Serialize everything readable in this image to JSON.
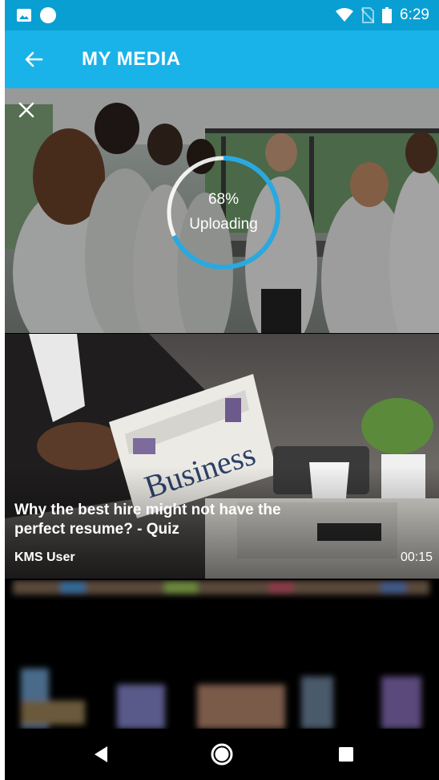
{
  "status_bar": {
    "time": "6:29",
    "icons": [
      "image-icon",
      "circle-icon",
      "wifi-icon",
      "no-sim-icon",
      "battery-icon"
    ]
  },
  "app_bar": {
    "back_icon": "arrow-back-icon",
    "title": "MY MEDIA"
  },
  "upload": {
    "close_icon": "close-icon",
    "progress_text": "68%",
    "progress_fraction": 0.68,
    "status_label": "Uploading",
    "ring_color": "#2aa9e0"
  },
  "media_items": [
    {
      "title": "Why the best hire might not have the perfect resume? - Quiz",
      "author": "KMS User",
      "duration": "00:15",
      "newspaper_text": "Business"
    }
  ],
  "nav_bar": {
    "icons": [
      "nav-back-icon",
      "nav-home-icon",
      "nav-recent-apps-icon"
    ]
  },
  "colors": {
    "status_bar": "#0a9fd2",
    "app_bar": "#1ab3e9"
  }
}
